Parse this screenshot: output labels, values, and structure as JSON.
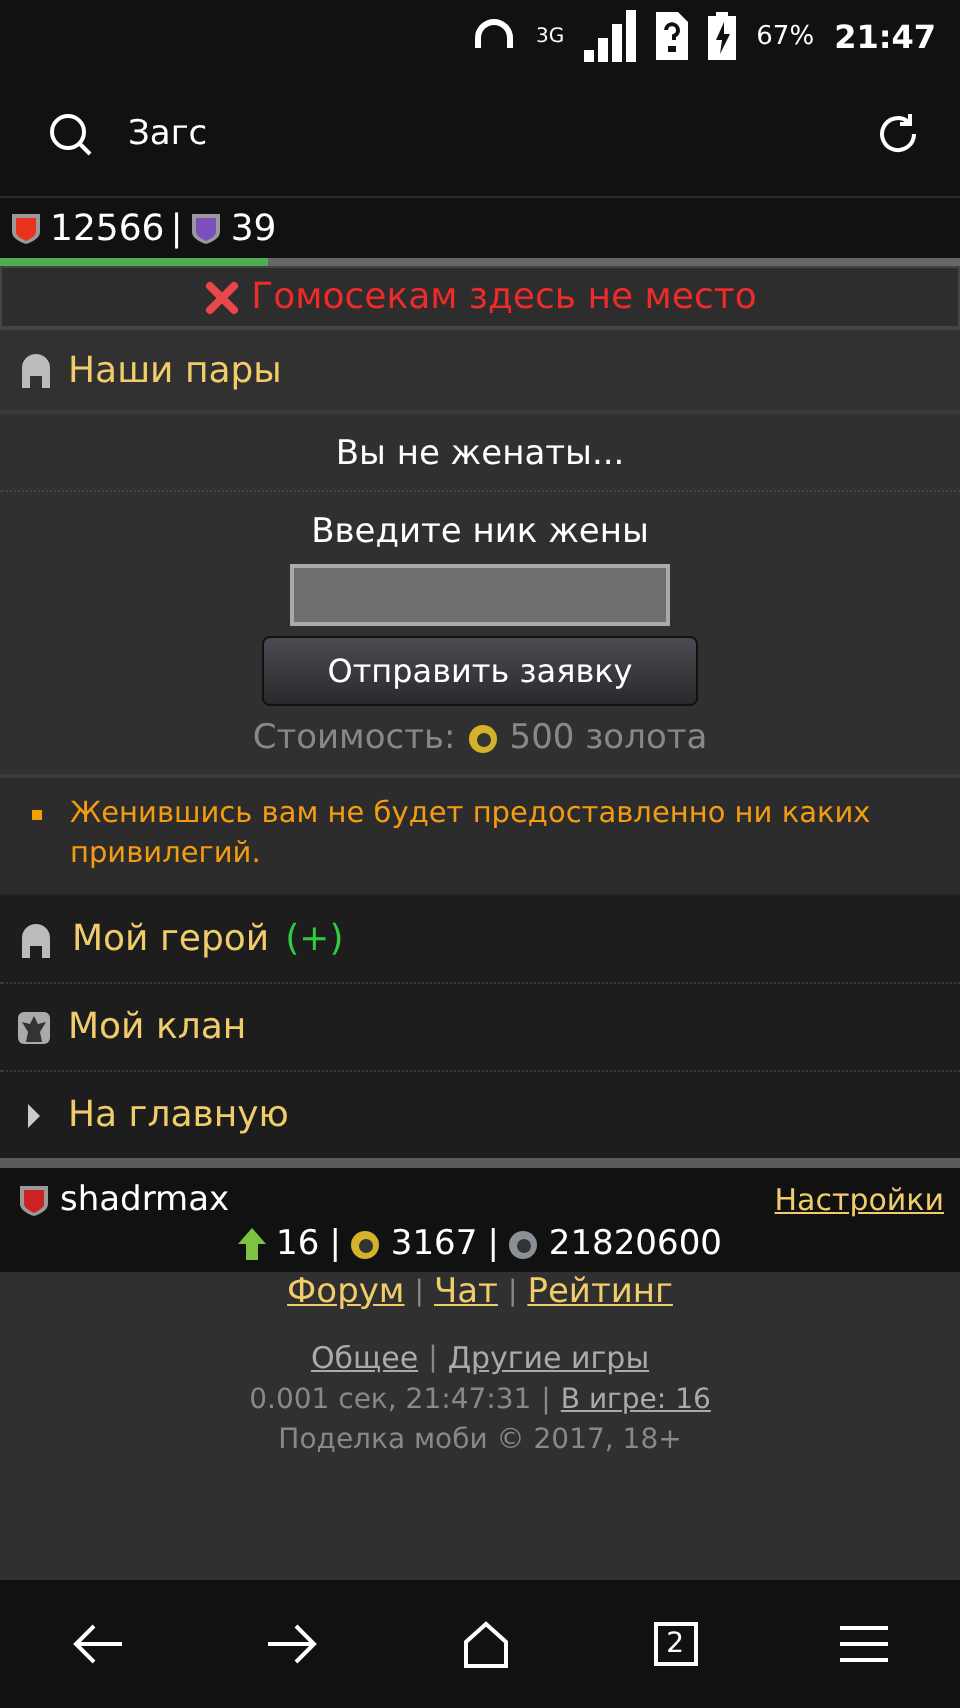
{
  "status_bar": {
    "network": "3G",
    "battery": "67%",
    "time": "21:47"
  },
  "toolbar": {
    "title": "Загс"
  },
  "stats": {
    "health": "12566",
    "separator": "|",
    "mana": "39"
  },
  "progress": {
    "level": 0.28
  },
  "error": {
    "text": "Гомосекам здесь не место"
  },
  "section": {
    "title": "Наши пары"
  },
  "marriage": {
    "status": "Вы не женаты...",
    "label": "Введите ник жены",
    "button": "Отправить заявку",
    "cost_label": "Стоимость:",
    "cost_value": "500 золота"
  },
  "note": {
    "text": "Женившись вам не будет предоставленно ни каких привилегий."
  },
  "menu": [
    {
      "kind": "hero",
      "label": "Мой герой",
      "badge": "(+)"
    },
    {
      "kind": "clan",
      "label": "Мой клан"
    },
    {
      "kind": "home",
      "label": "На главную"
    }
  ],
  "user": {
    "name": "shadrmax",
    "settings": "Настройки",
    "level": "16",
    "gold": "3167",
    "silver": "21820600",
    "separator": "|"
  },
  "footer": {
    "links": [
      "Форум",
      "Чат",
      "Рейтинг"
    ],
    "links2": [
      "Общее",
      "Другие игры"
    ],
    "timing": "0.001 сек, 21:47:31",
    "online": "В игре: 16",
    "copyright": "Поделка моби © 2017, 18+",
    "separator": "|"
  },
  "nav": {
    "tabs": "2"
  }
}
